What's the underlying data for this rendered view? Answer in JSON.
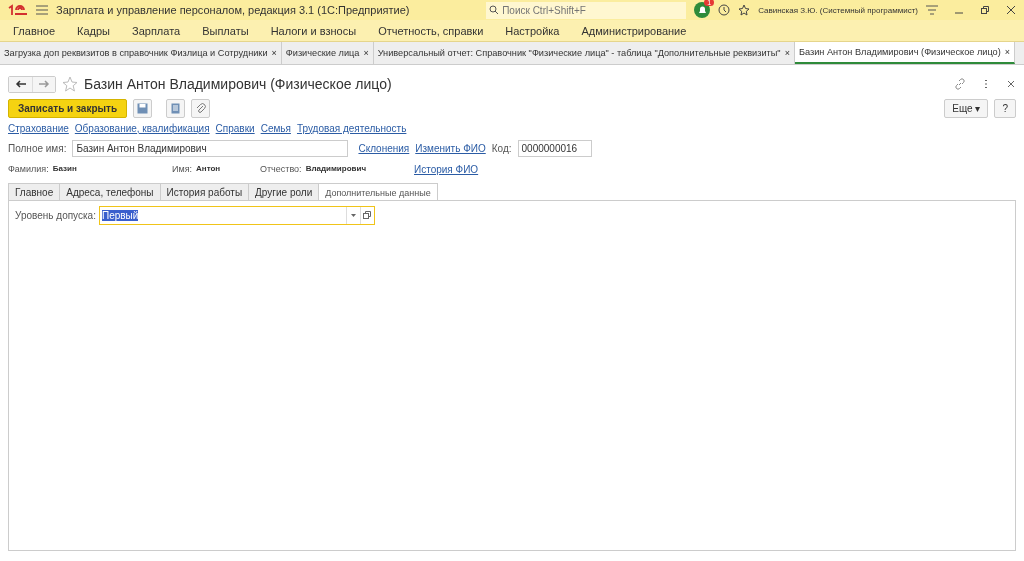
{
  "window": {
    "title": "Зарплата и управление персоналом, редакция 3.1  (1С:Предприятие)",
    "search": {
      "placeholder": "Поиск Ctrl+Shift+F"
    },
    "notifications": "1",
    "user": "Савинская З.Ю. (Системный программист)"
  },
  "menu": [
    "Главное",
    "Кадры",
    "Зарплата",
    "Выплаты",
    "Налоги и взносы",
    "Отчетность, справки",
    "Настройка",
    "Администрирование"
  ],
  "open_tabs": [
    {
      "label": "Загрузка доп реквизитов в справочник Физлица и Сотрудники",
      "close": "×",
      "selected": false
    },
    {
      "label": "Физические лица",
      "close": "×",
      "selected": false
    },
    {
      "label": "Универсальный отчет: Справочник \"Физические лица\" - таблица \"Дополнительные реквизиты\"",
      "close": "×",
      "selected": false
    },
    {
      "label": "Базин Антон Владимирович (Физическое лицо)",
      "close": "×",
      "selected": true
    }
  ],
  "form": {
    "title": "Базин Антон Владимирович (Физическое лицо)",
    "favorite": false,
    "buttons": {
      "save_close": "Записать и закрыть",
      "more": "Еще",
      "more_caret": "▾",
      "help": "?"
    },
    "links": [
      "Страхование",
      "Образование, квалификация",
      "Справки",
      "Семья",
      "Трудовая деятельность"
    ],
    "full_name": {
      "label": "Полное имя:",
      "value": "Базин Антон Владимирович"
    },
    "name_links": [
      "Склонения",
      "Изменить ФИО"
    ],
    "code": {
      "label": "Код:",
      "value": "0000000016"
    },
    "name_parts": [
      {
        "label": "Фамилия:",
        "value": "Базин"
      },
      {
        "label": "Имя:",
        "value": "Антон"
      },
      {
        "label": "Отчество:",
        "value": "Владимирович"
      }
    ],
    "history_link": "История ФИО",
    "tabs": [
      {
        "label": "Главное",
        "selected": false
      },
      {
        "label": "Адреса, телефоны",
        "selected": false
      },
      {
        "label": "История работы",
        "selected": false
      },
      {
        "label": "Другие роли",
        "selected": false
      },
      {
        "label": "Дополнительные данные",
        "selected": true
      }
    ],
    "access_level": {
      "label": "Уровень допуска:",
      "value": "Первый"
    }
  }
}
